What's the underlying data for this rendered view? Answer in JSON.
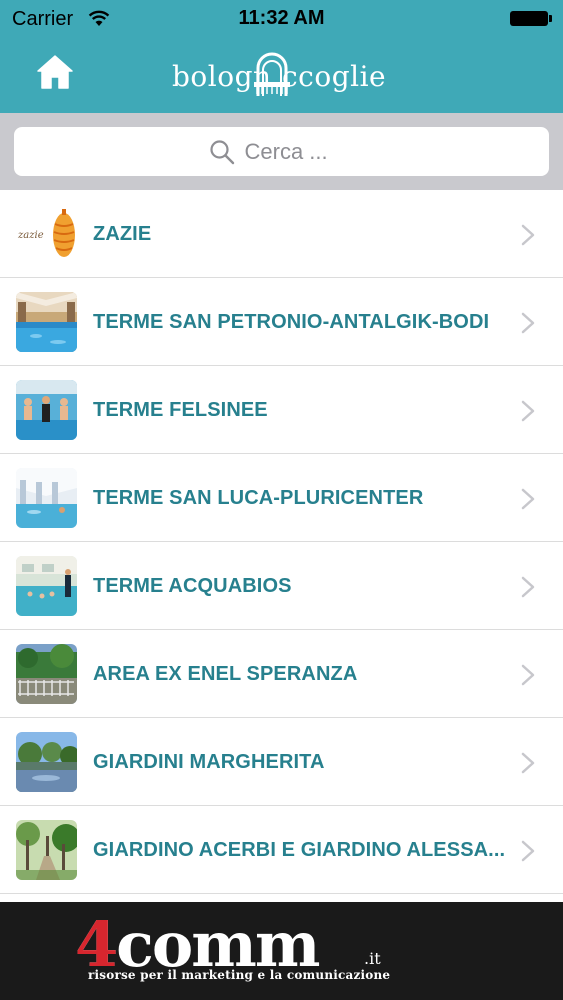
{
  "status_bar": {
    "carrier": "Carrier",
    "time": "11:32 AM"
  },
  "nav": {
    "logo_left": "bologn",
    "logo_right": "ccoglie",
    "home_icon": "home-icon"
  },
  "search": {
    "placeholder": "Cerca ..."
  },
  "list": {
    "items": [
      {
        "label": "ZAZIE",
        "thumb": "zazie-logo"
      },
      {
        "label": "TERME SAN PETRONIO-ANTALGIK-BODI",
        "thumb": "indoor-pool-photo"
      },
      {
        "label": "TERME FELSINEE",
        "thumb": "pool-people-photo"
      },
      {
        "label": "TERME SAN LUCA-PLURICENTER",
        "thumb": "pool-hall-photo"
      },
      {
        "label": "TERME ACQUABIOS",
        "thumb": "aqua-class-photo"
      },
      {
        "label": "AREA EX ENEL SPERANZA",
        "thumb": "park-fence-photo"
      },
      {
        "label": "GIARDINI MARGHERITA",
        "thumb": "lake-trees-photo"
      },
      {
        "label": "GIARDINO ACERBI E GIARDINO ALESSA...",
        "thumb": "garden-path-photo"
      }
    ]
  },
  "banner": {
    "brand_main": "4comm",
    "brand_suffix": ".it",
    "tagline": "risorse per il marketing e la comunicazione"
  },
  "colors": {
    "brand_teal": "#3fa9b7",
    "label_teal": "#27808e",
    "search_bg": "#c9c9ce",
    "banner_bg": "#1a1a1a",
    "banner_red": "#d7262e"
  }
}
